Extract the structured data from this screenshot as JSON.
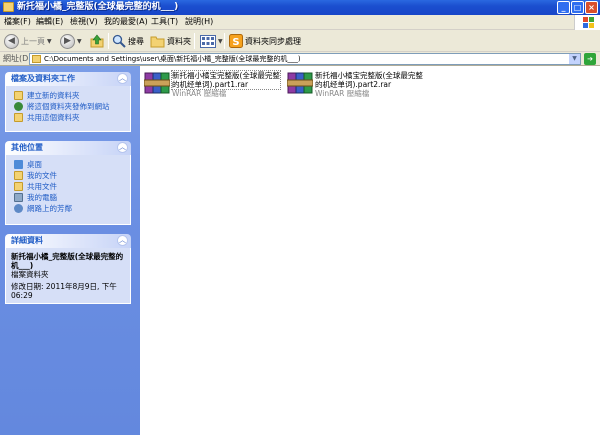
{
  "window": {
    "title": "新托福小橘_完整版(全球最完整的机___)"
  },
  "menu": [
    "檔案(F)",
    "編輯(E)",
    "檢視(V)",
    "我的最愛(A)",
    "工具(T)",
    "說明(H)"
  ],
  "toolbar": {
    "back": "上一頁",
    "search": "搜尋",
    "folders": "資料夾",
    "sync": "資料夾同步處理"
  },
  "address": {
    "label": "網址(D)",
    "path": "C:\\Documents and Settings\\user\\桌面\\新托福小橘_完整版(全球最完整的机___)"
  },
  "tasks": {
    "title": "檔案及資料夾工作",
    "items": [
      "建立新的資料夾",
      "將這個資料夾發佈到網站",
      "共用這個資料夾"
    ]
  },
  "places": {
    "title": "其他位置",
    "items": [
      "桌面",
      "我的文件",
      "共用文件",
      "我的電腦",
      "網路上的芳鄰"
    ]
  },
  "details": {
    "title": "詳細資料",
    "name": "新托福小橘_完整版(全球最完整的机___)",
    "type": "檔案資料夾",
    "modified": "修改日期: 2011年8月9日, 下午 06:29"
  },
  "files": [
    {
      "name": "新托福小橘宝完整版(全球最完整的机经单词).part1.rar",
      "type": "WinRAR 壓縮檔"
    },
    {
      "name": "新托福小橘宝完整版(全球最完整的机经单词).part2.rar",
      "type": "WinRAR 壓縮檔"
    }
  ],
  "colors": {
    "titlebar": "#1b4fcf",
    "pane": "#6b8fe3",
    "panelBody": "#d6dff7",
    "link": "#215dc6"
  }
}
